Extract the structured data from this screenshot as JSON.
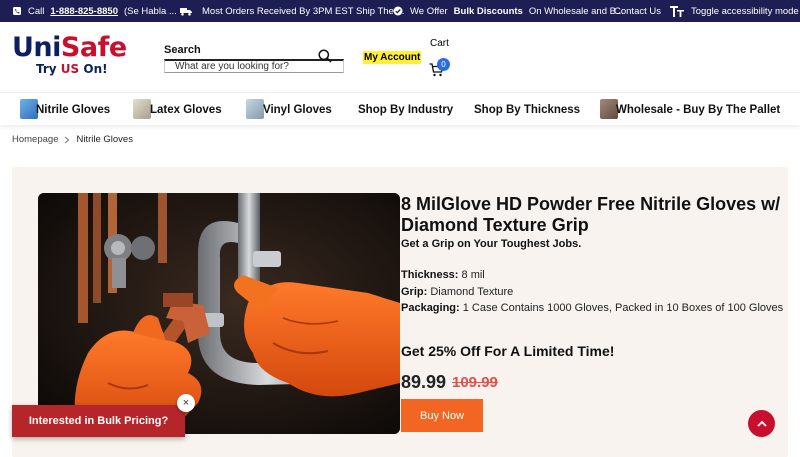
{
  "topbar": {
    "phone_prefix": "Call",
    "phone_number": "1-888-825-8850",
    "phone_suffix": "(Se Habla ...",
    "shipping_text": "Most Orders Received By 3PM EST Ship The ...",
    "discount_prefix": "We Offer",
    "discount_bold": "Bulk Discounts",
    "discount_suffix": "On Wholesale and B...",
    "contact": "Contact Us",
    "accessibility": "Toggle accessibility mode"
  },
  "logo": {
    "main_left": "Uni",
    "main_right": "Safe",
    "tag_left": "Try",
    "tag_mid": "US",
    "tag_right": "On!"
  },
  "search": {
    "label": "Search",
    "placeholder": "What are you looking for?"
  },
  "account": {
    "label": "My Account"
  },
  "cart": {
    "label": "Cart",
    "count": "0"
  },
  "nav": {
    "items": [
      {
        "label": "Nitrile Gloves",
        "thumb_color": "#4a8fd6"
      },
      {
        "label": "Latex Gloves",
        "thumb_color": "#c8c2b0"
      },
      {
        "label": "Vinyl Gloves",
        "thumb_color": "#a6bccd"
      },
      {
        "label": "Shop By Industry"
      },
      {
        "label": "Shop By Thickness"
      },
      {
        "label": "Wholesale - Buy By The Pallet",
        "thumb_color": "#8c7566"
      }
    ]
  },
  "breadcrumb": {
    "home": "Homepage",
    "current": "Nitrile Gloves"
  },
  "product": {
    "title": "8 MilGlove HD Powder Free Nitrile Gloves w/ Diamond Texture Grip",
    "subtitle": "Get a Grip on Your Toughest Jobs.",
    "specs": [
      {
        "label": "Thickness:",
        "value": "8 mil"
      },
      {
        "label": "Grip:",
        "value": "Diamond Texture"
      },
      {
        "label": "Packaging:",
        "value": "1 Case Contains 1000 Gloves, Packed in 10 Boxes of 100 Gloves"
      }
    ],
    "promo": "Get 25% Off For A Limited Time!",
    "price": "89.99",
    "old_price": "109.99",
    "buy_label": "Buy Now"
  },
  "bulk": {
    "label": "Interested in Bulk Pricing?",
    "close": "×"
  },
  "colors": {
    "topbar": "#1d1f54",
    "brand_navy": "#0d1f5c",
    "brand_red": "#c8102e",
    "buy": "#f26522",
    "panel": "#f8f3ef"
  }
}
